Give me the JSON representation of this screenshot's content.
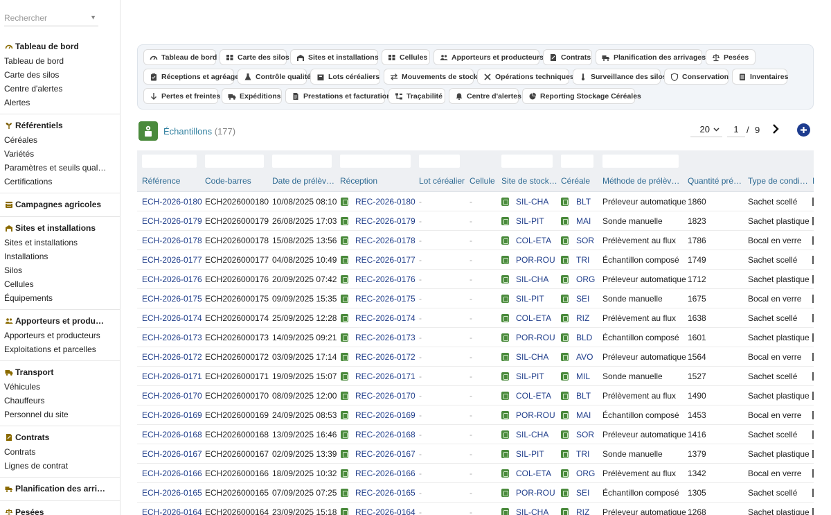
{
  "search": {
    "placeholder": "Rechercher"
  },
  "sidebar": {
    "sections": [
      {
        "title": "Tableau de bord",
        "icon": "gauge-icon",
        "items": [
          "Tableau de bord",
          "Carte des silos",
          "Centre d'alertes",
          "Alertes"
        ]
      },
      {
        "title": "Référentiels",
        "icon": "sprout-icon",
        "items": [
          "Céréales",
          "Variétés",
          "Paramètres et seuils qual…",
          "Certifications"
        ]
      },
      {
        "title": "Campagnes agricoles",
        "icon": "calendar-icon",
        "items": []
      },
      {
        "title": "Sites et installations",
        "icon": "warehouse-icon",
        "items": [
          "Sites et installations",
          "Installations",
          "Silos",
          "Cellules",
          "Équipements"
        ]
      },
      {
        "title": "Apporteurs et produ…",
        "icon": "users-icon",
        "items": [
          "Apporteurs et producteurs",
          "Exploitations et parcelles"
        ]
      },
      {
        "title": "Transport",
        "icon": "truck-icon",
        "items": [
          "Véhicules",
          "Chauffeurs",
          "Personnel du site"
        ]
      },
      {
        "title": "Contrats",
        "icon": "contract-icon",
        "items": [
          "Contrats",
          "Lignes de contrat"
        ]
      },
      {
        "title": "Planification des arri…",
        "icon": "truck-loading-icon",
        "items": []
      },
      {
        "title": "Pesées",
        "icon": "scale-icon",
        "items": []
      }
    ]
  },
  "tabs": [
    {
      "label": "Tableau de bord",
      "icon": "gauge-icon"
    },
    {
      "label": "Carte des silos",
      "icon": "grid-icon"
    },
    {
      "label": "Sites et installations",
      "icon": "warehouse-icon"
    },
    {
      "label": "Cellules",
      "icon": "grid-icon"
    },
    {
      "label": "Apporteurs et producteurs",
      "icon": "users-icon"
    },
    {
      "label": "Contrats",
      "icon": "contract-icon"
    },
    {
      "label": "Planification des arrivages",
      "icon": "truck-loading-icon"
    },
    {
      "label": "Pesées",
      "icon": "scale-icon"
    },
    {
      "label": "Réceptions et agréage",
      "icon": "clipboard-icon"
    },
    {
      "label": "Contrôle qualité",
      "icon": "flask-icon"
    },
    {
      "label": "Lots céréaliers",
      "icon": "box-icon"
    },
    {
      "label": "Mouvements de stock",
      "icon": "exchange-icon"
    },
    {
      "label": "Opérations techniques",
      "icon": "tools-icon"
    },
    {
      "label": "Surveillance des silos",
      "icon": "thermometer-icon"
    },
    {
      "label": "Conservation",
      "icon": "shield-icon"
    },
    {
      "label": "Inventaires",
      "icon": "list-icon"
    },
    {
      "label": "Pertes et freintes",
      "icon": "arrow-down-icon"
    },
    {
      "label": "Expéditions",
      "icon": "truck-icon"
    },
    {
      "label": "Prestations et facturation",
      "icon": "invoice-icon"
    },
    {
      "label": "Traçabilité",
      "icon": "sitemap-icon"
    },
    {
      "label": "Centre d'alertes",
      "icon": "bell-icon"
    },
    {
      "label": "Reporting Stockage Céréales",
      "icon": "chart-pie-icon"
    }
  ],
  "page": {
    "title": "Échantillons",
    "count": "(177)"
  },
  "pagination": {
    "page_size": "20",
    "current": "1",
    "separator": "/",
    "total": "9"
  },
  "table": {
    "columns": [
      "Référence",
      "Code-barres",
      "Date de prélèv…",
      "Réception",
      "Lot céréalier",
      "Cellule",
      "Site de stock…",
      "Céréale",
      "Méthode de prélève…",
      "Quantité pré…",
      "Type de condi…",
      "L"
    ],
    "rows": [
      [
        "ECH-2026-0180",
        "ECH2026000180",
        "10/08/2025 08:10",
        "REC-2026-0180",
        "-",
        "-",
        "SIL-CHA",
        "BLT",
        "Préleveur automatique",
        "1860",
        "Sachet scellé"
      ],
      [
        "ECH-2026-0179",
        "ECH2026000179",
        "26/08/2025 17:03",
        "REC-2026-0179",
        "-",
        "-",
        "SIL-PIT",
        "MAI",
        "Sonde manuelle",
        "1823",
        "Sachet plastique"
      ],
      [
        "ECH-2026-0178",
        "ECH2026000178",
        "15/08/2025 13:56",
        "REC-2026-0178",
        "-",
        "-",
        "COL-ETA",
        "SOR",
        "Prélèvement au flux",
        "1786",
        "Bocal en verre"
      ],
      [
        "ECH-2026-0177",
        "ECH2026000177",
        "04/08/2025 10:49",
        "REC-2026-0177",
        "-",
        "-",
        "POR-ROU",
        "TRI",
        "Échantillon composé",
        "1749",
        "Sachet scellé"
      ],
      [
        "ECH-2026-0176",
        "ECH2026000176",
        "20/09/2025 07:42",
        "REC-2026-0176",
        "-",
        "-",
        "SIL-CHA",
        "ORG",
        "Préleveur automatique",
        "1712",
        "Sachet plastique"
      ],
      [
        "ECH-2026-0175",
        "ECH2026000175",
        "09/09/2025 15:35",
        "REC-2026-0175",
        "-",
        "-",
        "SIL-PIT",
        "SEI",
        "Sonde manuelle",
        "1675",
        "Bocal en verre"
      ],
      [
        "ECH-2026-0174",
        "ECH2026000174",
        "25/09/2025 12:28",
        "REC-2026-0174",
        "-",
        "-",
        "COL-ETA",
        "RIZ",
        "Prélèvement au flux",
        "1638",
        "Sachet scellé"
      ],
      [
        "ECH-2026-0173",
        "ECH2026000173",
        "14/09/2025 09:21",
        "REC-2026-0173",
        "-",
        "-",
        "POR-ROU",
        "BLD",
        "Échantillon composé",
        "1601",
        "Sachet plastique"
      ],
      [
        "ECH-2026-0172",
        "ECH2026000172",
        "03/09/2025 17:14",
        "REC-2026-0172",
        "-",
        "-",
        "SIL-CHA",
        "AVO",
        "Préleveur automatique",
        "1564",
        "Bocal en verre"
      ],
      [
        "ECH-2026-0171",
        "ECH2026000171",
        "19/09/2025 15:07",
        "REC-2026-0171",
        "-",
        "-",
        "SIL-PIT",
        "MIL",
        "Sonde manuelle",
        "1527",
        "Sachet scellé"
      ],
      [
        "ECH-2026-0170",
        "ECH2026000170",
        "08/09/2025 12:00",
        "REC-2026-0170",
        "-",
        "-",
        "COL-ETA",
        "BLT",
        "Prélèvement au flux",
        "1490",
        "Sachet plastique"
      ],
      [
        "ECH-2026-0169",
        "ECH2026000169",
        "24/09/2025 08:53",
        "REC-2026-0169",
        "-",
        "-",
        "POR-ROU",
        "MAI",
        "Échantillon composé",
        "1453",
        "Bocal en verre"
      ],
      [
        "ECH-2026-0168",
        "ECH2026000168",
        "13/09/2025 16:46",
        "REC-2026-0168",
        "-",
        "-",
        "SIL-CHA",
        "SOR",
        "Préleveur automatique",
        "1416",
        "Sachet scellé"
      ],
      [
        "ECH-2026-0167",
        "ECH2026000167",
        "02/09/2025 13:39",
        "REC-2026-0167",
        "-",
        "-",
        "SIL-PIT",
        "TRI",
        "Sonde manuelle",
        "1379",
        "Sachet plastique"
      ],
      [
        "ECH-2026-0166",
        "ECH2026000166",
        "18/09/2025 10:32",
        "REC-2026-0166",
        "-",
        "-",
        "COL-ETA",
        "ORG",
        "Prélèvement au flux",
        "1342",
        "Bocal en verre"
      ],
      [
        "ECH-2026-0165",
        "ECH2026000165",
        "07/09/2025 07:25",
        "REC-2026-0165",
        "-",
        "-",
        "POR-ROU",
        "SEI",
        "Échantillon composé",
        "1305",
        "Sachet scellé"
      ],
      [
        "ECH-2026-0164",
        "ECH2026000164",
        "23/09/2025 15:18",
        "REC-2026-0164",
        "-",
        "-",
        "SIL-CHA",
        "RIZ",
        "Préleveur automatique",
        "1268",
        "Sachet plastique"
      ]
    ]
  },
  "colors": {
    "accent": "#2f7f9f",
    "link": "#1f3d8a",
    "chip": "#4a8a3c",
    "add_button": "#1d3c8f"
  }
}
